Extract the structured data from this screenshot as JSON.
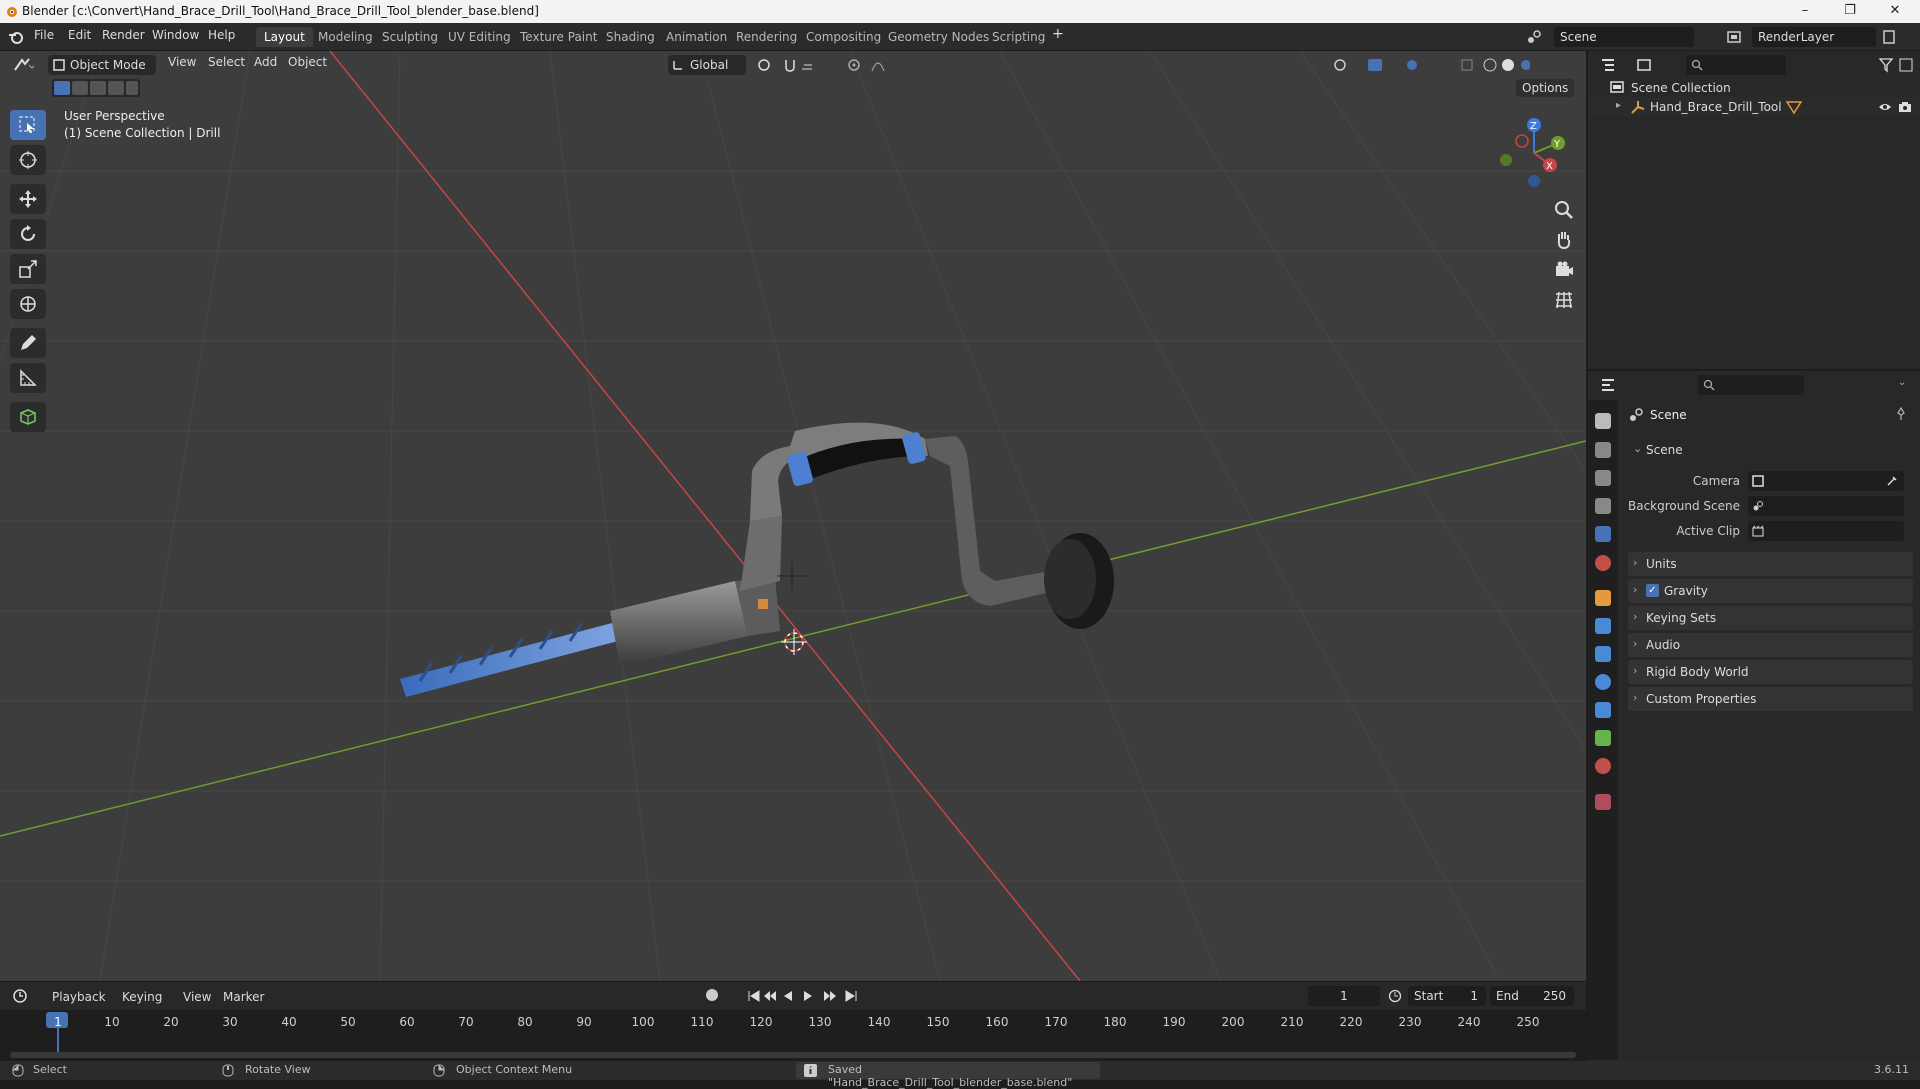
{
  "window": {
    "title": "Blender [c:\\Convert\\Hand_Brace_Drill_Tool\\Hand_Brace_Drill_Tool_blender_base.blend]",
    "minimize": "–",
    "maximize": "❐",
    "close": "✕"
  },
  "menu": [
    "File",
    "Edit",
    "Render",
    "Window",
    "Help"
  ],
  "workspaces": [
    "Layout",
    "Modeling",
    "Sculpting",
    "UV Editing",
    "Texture Paint",
    "Shading",
    "Animation",
    "Rendering",
    "Compositing",
    "Geometry Nodes",
    "Scripting"
  ],
  "active_workspace": "Layout",
  "scene_name": "Scene",
  "view_layer": "RenderLayer",
  "viewport_header": {
    "mode": "Object Mode",
    "menus": [
      "View",
      "Select",
      "Add",
      "Object"
    ],
    "transform_orientation": "Global",
    "options": "Options"
  },
  "viewport_overlay": {
    "line1": "User Perspective",
    "line2": "(1) Scene Collection | Drill"
  },
  "gizmo": {
    "z": "Z",
    "y": "Y",
    "x": "X"
  },
  "outliner": {
    "root": "Scene Collection",
    "items": [
      {
        "name": "Hand_Brace_Drill_Tool"
      }
    ]
  },
  "properties": {
    "context": "Scene",
    "section": "Scene",
    "fields": [
      {
        "label": "Camera",
        "value": ""
      },
      {
        "label": "Background Scene",
        "value": ""
      },
      {
        "label": "Active Clip",
        "value": ""
      }
    ],
    "panels": [
      "Units",
      "Gravity",
      "Keying Sets",
      "Audio",
      "Rigid Body World",
      "Custom Properties"
    ],
    "gravity_checked": true
  },
  "timeline": {
    "menus": [
      "Playback",
      "Keying",
      "View",
      "Marker"
    ],
    "current_frame": "1",
    "start_label": "Start",
    "start": "1",
    "end_label": "End",
    "end": "250",
    "ticks": [
      "1",
      "10",
      "20",
      "30",
      "40",
      "50",
      "60",
      "70",
      "80",
      "90",
      "100",
      "110",
      "120",
      "130",
      "140",
      "150",
      "160",
      "170",
      "180",
      "190",
      "200",
      "210",
      "220",
      "230",
      "240",
      "250"
    ]
  },
  "statusbar": {
    "select": "Select",
    "rotate": "Rotate View",
    "context_menu": "Object Context Menu",
    "message": "Saved \"Hand_Brace_Drill_Tool_blender_base.blend\"",
    "version": "3.6.11"
  },
  "colors": {
    "accent": "#4772b3",
    "x_axis": "#c94545",
    "y_axis": "#6f9e2a",
    "z_axis": "#3b7be0",
    "drill_blue": "#4f7fd1"
  }
}
